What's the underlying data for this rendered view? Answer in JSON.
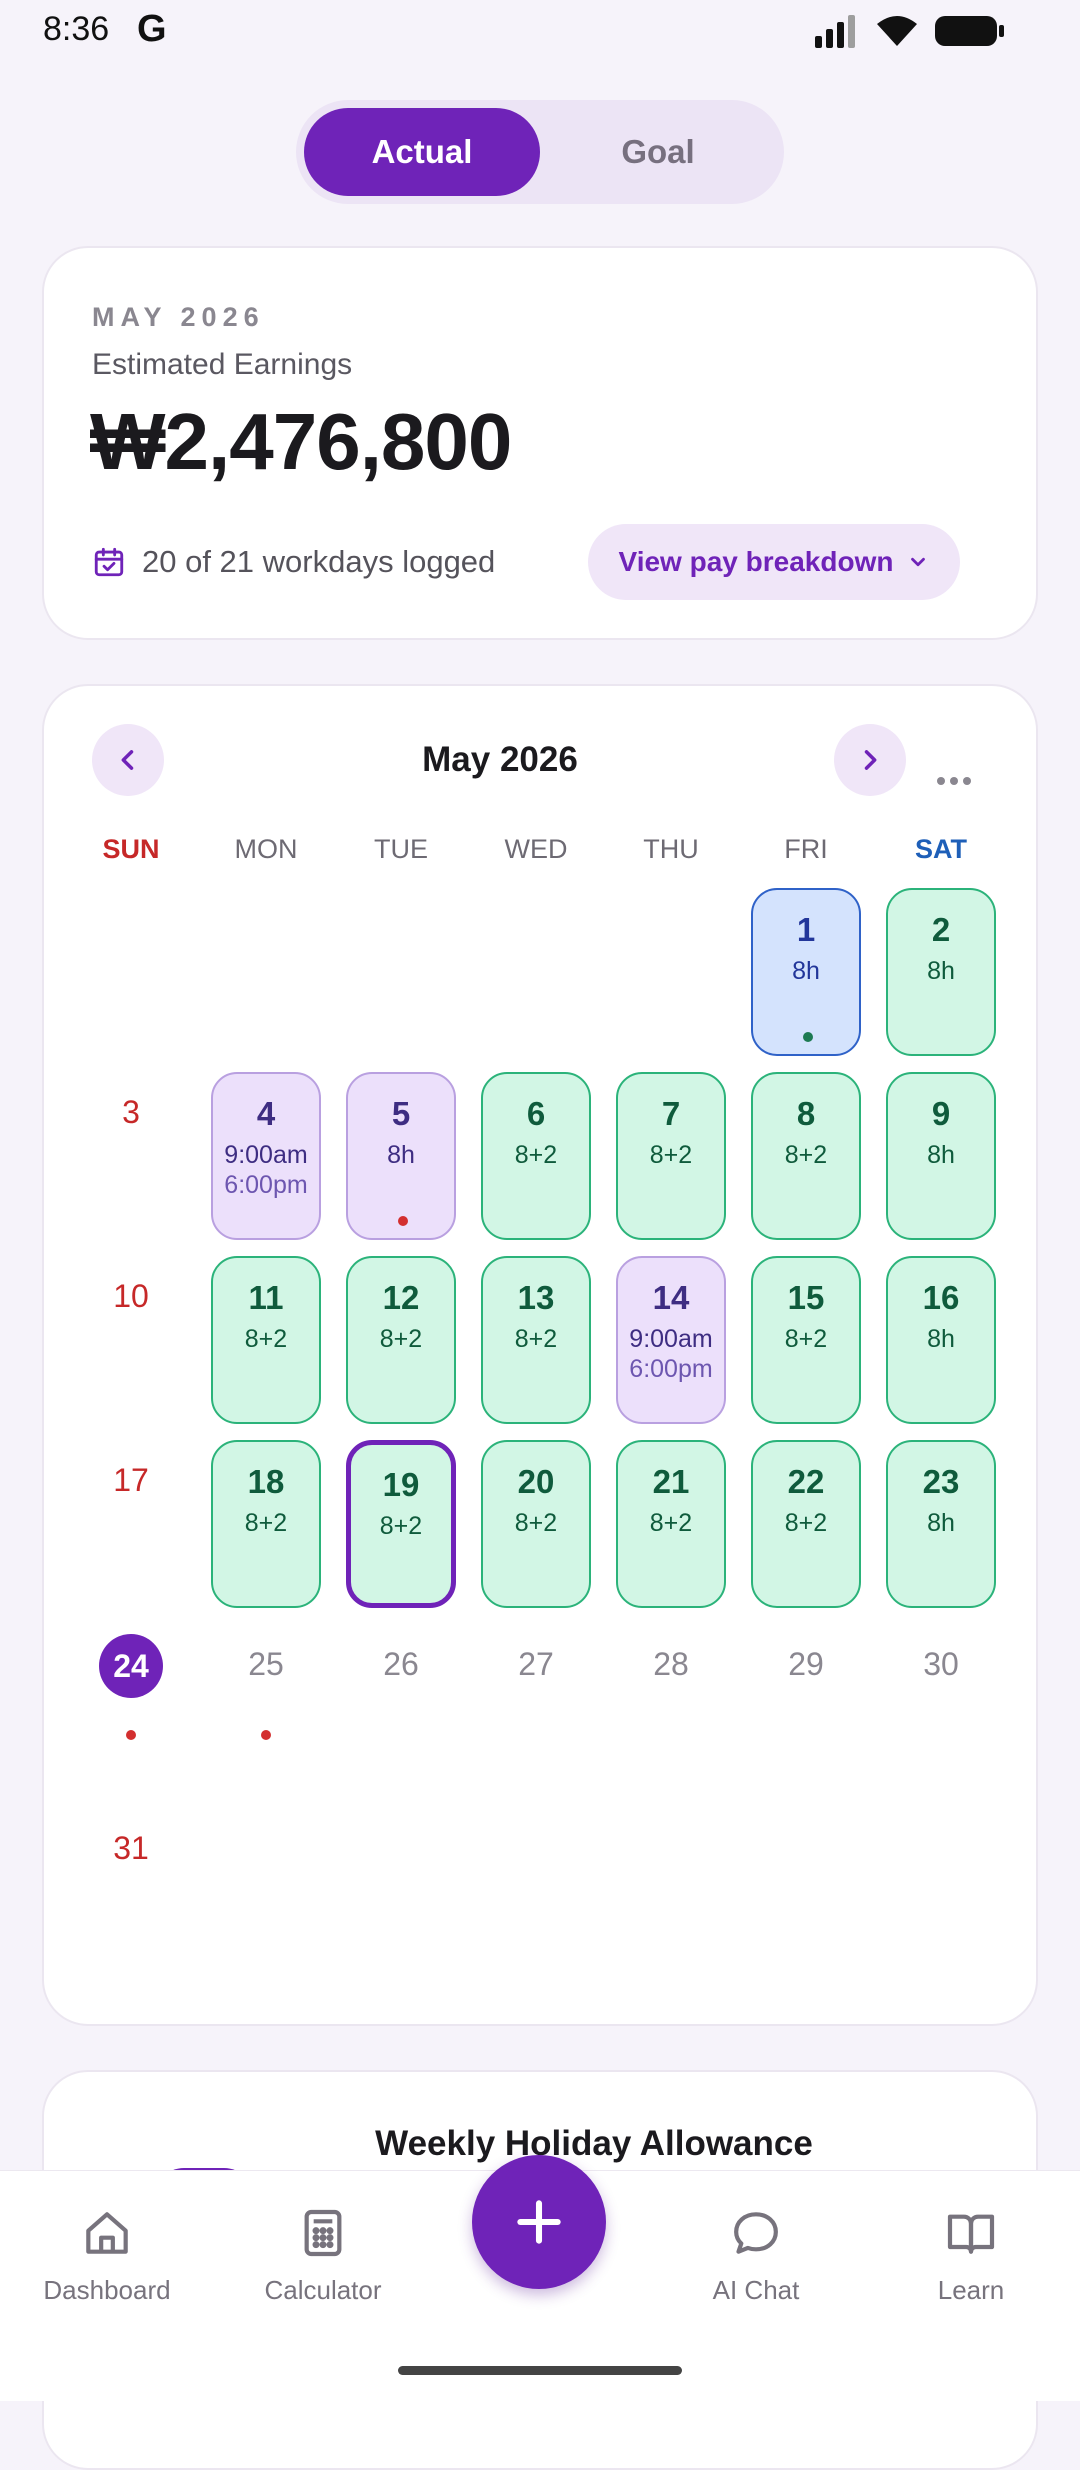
{
  "status_bar": {
    "time": "8:36",
    "g_icon": "G"
  },
  "toggle": {
    "actual": "Actual",
    "goal": "Goal"
  },
  "earnings": {
    "month_caption": "MAY 2026",
    "label": "Estimated Earnings",
    "amount": "₩2,476,800",
    "workdays_text": "20 of 21 workdays logged",
    "pay_breakdown_label": "View pay breakdown"
  },
  "calendar": {
    "title": "May 2026",
    "weekdays": [
      "SUN",
      "MON",
      "TUE",
      "WED",
      "THU",
      "FRI",
      "SAT"
    ],
    "days": [
      {
        "d": "1",
        "l1": "8h",
        "l2": "",
        "style": "blue",
        "dot": "green"
      },
      {
        "d": "2",
        "l1": "8h",
        "l2": "",
        "style": "green",
        "dot": ""
      },
      {
        "d": "3",
        "l1": "",
        "l2": "",
        "style": "sunday",
        "dot": ""
      },
      {
        "d": "4",
        "l1": "9:00am",
        "l2": "6:00pm",
        "style": "purple",
        "dot": ""
      },
      {
        "d": "5",
        "l1": "8h",
        "l2": "",
        "style": "purple",
        "dot": "red"
      },
      {
        "d": "6",
        "l1": "8+2",
        "l2": "",
        "style": "green",
        "dot": ""
      },
      {
        "d": "7",
        "l1": "8+2",
        "l2": "",
        "style": "green",
        "dot": ""
      },
      {
        "d": "8",
        "l1": "8+2",
        "l2": "",
        "style": "green",
        "dot": ""
      },
      {
        "d": "9",
        "l1": "8h",
        "l2": "",
        "style": "green",
        "dot": ""
      },
      {
        "d": "10",
        "l1": "",
        "l2": "",
        "style": "sunday",
        "dot": ""
      },
      {
        "d": "11",
        "l1": "8+2",
        "l2": "",
        "style": "green",
        "dot": ""
      },
      {
        "d": "12",
        "l1": "8+2",
        "l2": "",
        "style": "green",
        "dot": ""
      },
      {
        "d": "13",
        "l1": "8+2",
        "l2": "",
        "style": "green",
        "dot": ""
      },
      {
        "d": "14",
        "l1": "9:00am",
        "l2": "6:00pm",
        "style": "purple",
        "dot": ""
      },
      {
        "d": "15",
        "l1": "8+2",
        "l2": "",
        "style": "green",
        "dot": ""
      },
      {
        "d": "16",
        "l1": "8h",
        "l2": "",
        "style": "green",
        "dot": ""
      },
      {
        "d": "17",
        "l1": "",
        "l2": "",
        "style": "sunday",
        "dot": ""
      },
      {
        "d": "18",
        "l1": "8+2",
        "l2": "",
        "style": "green",
        "dot": ""
      },
      {
        "d": "19",
        "l1": "8+2",
        "l2": "",
        "style": "green-outlined",
        "dot": ""
      },
      {
        "d": "20",
        "l1": "8+2",
        "l2": "",
        "style": "green",
        "dot": ""
      },
      {
        "d": "21",
        "l1": "8+2",
        "l2": "",
        "style": "green",
        "dot": ""
      },
      {
        "d": "22",
        "l1": "8+2",
        "l2": "",
        "style": "green",
        "dot": ""
      },
      {
        "d": "23",
        "l1": "8h",
        "l2": "",
        "style": "green",
        "dot": ""
      },
      {
        "d": "24",
        "l1": "",
        "l2": "",
        "style": "today",
        "dot": "red"
      },
      {
        "d": "25",
        "l1": "",
        "l2": "",
        "style": "plain",
        "dot": "red"
      },
      {
        "d": "26",
        "l1": "",
        "l2": "",
        "style": "plain",
        "dot": ""
      },
      {
        "d": "27",
        "l1": "",
        "l2": "",
        "style": "plain",
        "dot": ""
      },
      {
        "d": "28",
        "l1": "",
        "l2": "",
        "style": "plain",
        "dot": ""
      },
      {
        "d": "29",
        "l1": "",
        "l2": "",
        "style": "plain",
        "dot": ""
      },
      {
        "d": "30",
        "l1": "",
        "l2": "",
        "style": "plain",
        "dot": ""
      },
      {
        "d": "31",
        "l1": "",
        "l2": "",
        "style": "sunday",
        "dot": ""
      }
    ]
  },
  "holiday_card": {
    "title": "Weekly Holiday Allowance"
  },
  "bottom_nav": {
    "dashboard": "Dashboard",
    "calculator": "Calculator",
    "ai_chat": "AI Chat",
    "learn": "Learn"
  },
  "colors": {
    "accent": "#6f23b8",
    "green_fill": "#d2f6e5",
    "purple_fill": "#ece0fb",
    "blue_fill": "#d4e3fd",
    "sunday_red": "#c62828",
    "saturday_blue": "#1e5fb8"
  }
}
